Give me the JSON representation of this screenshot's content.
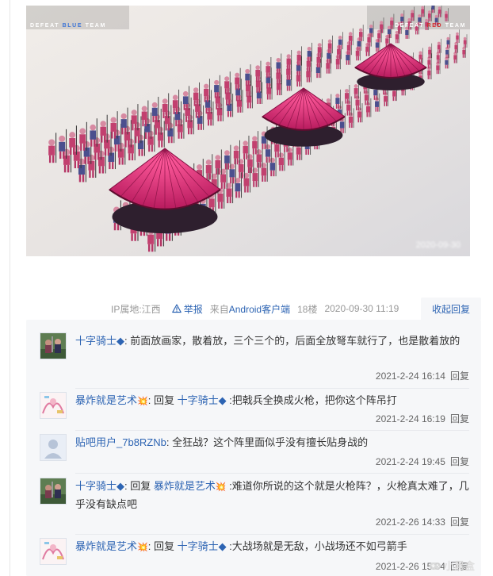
{
  "screenshot": {
    "hud_left": {
      "prefix": "DEFEAT",
      "team": "BLUE",
      "suffix": "TEAM"
    },
    "hud_right": {
      "prefix": "DEFEAT",
      "team": "RED",
      "suffix": "TEAM"
    },
    "blurred_time": "2020-09-30"
  },
  "post_meta": {
    "ip": "IP属地:江西",
    "report": "举报",
    "client_prefix": "来自",
    "client_link": "Android客户端",
    "floor": "18楼",
    "datetime": "2020-09-30 11:19",
    "collapse_label": "收起回复"
  },
  "replies": [
    {
      "user": "十字骑士◆",
      "reply_prefix": "",
      "reply_to": "",
      "text": ": 前面放画家，散着放，三个三个的，后面全放弩车就行了，也是散着放的",
      "time": "2021-2-24 16:14",
      "reply_label": "回复",
      "avatar": "knight"
    },
    {
      "user": "暴炸就是艺术",
      "user_emoji": "💥",
      "reply_prefix": ": 回复 ",
      "reply_to": "十字骑士◆",
      "text": " :把戟兵全换成火枪，把你这个阵吊打",
      "time": "2021-2-24 16:19",
      "reply_label": "回复",
      "avatar": "art"
    },
    {
      "user": "贴吧用户_7b8RZNb",
      "reply_prefix": "",
      "reply_to": "",
      "text": ": 全狂战？这个阵里面似乎没有擅长贴身战的",
      "time": "2021-2-24 19:45",
      "reply_label": "回复",
      "avatar": "default"
    },
    {
      "user": "十字骑士◆",
      "reply_prefix": ": 回复 ",
      "reply_to": "暴炸就是艺术",
      "reply_to_emoji": "💥",
      "text": " :难道你所说的这个就是火枪阵？，火枪真太难了，几乎没有缺点吧",
      "time": "2021-2-26 14:33",
      "reply_label": "回复",
      "avatar": "knight"
    },
    {
      "user": "暴炸就是艺术",
      "user_emoji": "💥",
      "reply_prefix": ": 回复 ",
      "reply_to": "十字骑士◆",
      "text": " :大战场就是无敌，小战场还不如弓箭手",
      "time": "2021-2-26 15:34",
      "reply_label": "回复",
      "avatar": "art"
    }
  ],
  "watermark": "小黑盒"
}
